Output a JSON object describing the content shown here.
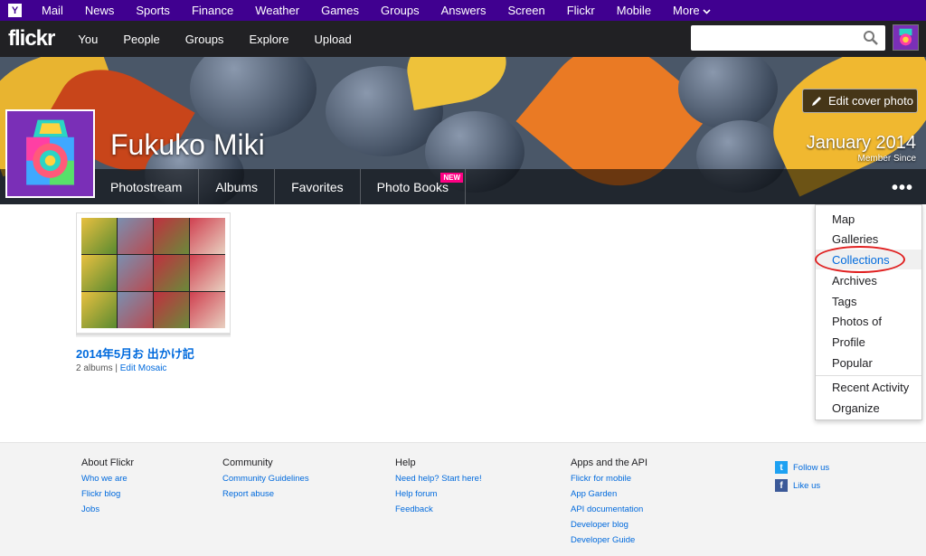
{
  "yahoo_bar": {
    "logo": "Y",
    "items": [
      "Mail",
      "News",
      "Sports",
      "Finance",
      "Weather",
      "Games",
      "Groups",
      "Answers",
      "Screen",
      "Flickr",
      "Mobile",
      "More"
    ]
  },
  "flickr_nav": {
    "logo": "flickr",
    "items": [
      "You",
      "People",
      "Groups",
      "Explore",
      "Upload"
    ],
    "search_placeholder": ""
  },
  "cover": {
    "edit_cover_label": "Edit cover photo",
    "profile_name": "Fukuko Miki",
    "member_since_date": "January 2014",
    "member_since_label": "Member Since"
  },
  "subnav": {
    "items": [
      "Photostream",
      "Albums",
      "Favorites",
      "Photo Books"
    ],
    "new_badge": "NEW",
    "more": "•••"
  },
  "collection": {
    "title": "2014年5月お 出かけ記",
    "albums_count": "2 albums",
    "separator": "|",
    "edit_mosaic": "Edit Mosaic"
  },
  "dropdown": {
    "items": [
      "Map",
      "Galleries",
      "Collections",
      "Archives",
      "Tags",
      "Photos of",
      "Profile",
      "Popular",
      "Recent Activity",
      "Organize"
    ],
    "active": "Collections"
  },
  "footer": {
    "columns": [
      {
        "heading": "About Flickr",
        "links": [
          "Who we are",
          "Flickr blog",
          "Jobs"
        ]
      },
      {
        "heading": "Community",
        "links": [
          "Community Guidelines",
          "Report abuse"
        ]
      },
      {
        "heading": "Help",
        "links": [
          "Need help? Start here!",
          "Help forum",
          "Feedback"
        ]
      },
      {
        "heading": "Apps and the API",
        "links": [
          "Flickr for mobile",
          "App Garden",
          "API documentation",
          "Developer blog",
          "Developer Guide"
        ]
      }
    ],
    "social": [
      {
        "label": "Follow us",
        "icon": "twitter-icon"
      },
      {
        "label": "Like us",
        "icon": "facebook-icon"
      }
    ]
  },
  "colors": {
    "yahoo_purple": "#400090",
    "flickr_dark": "#212124",
    "link_blue": "#006add",
    "new_badge_pink": "#ff0084",
    "annotation_red": "#e02020"
  }
}
